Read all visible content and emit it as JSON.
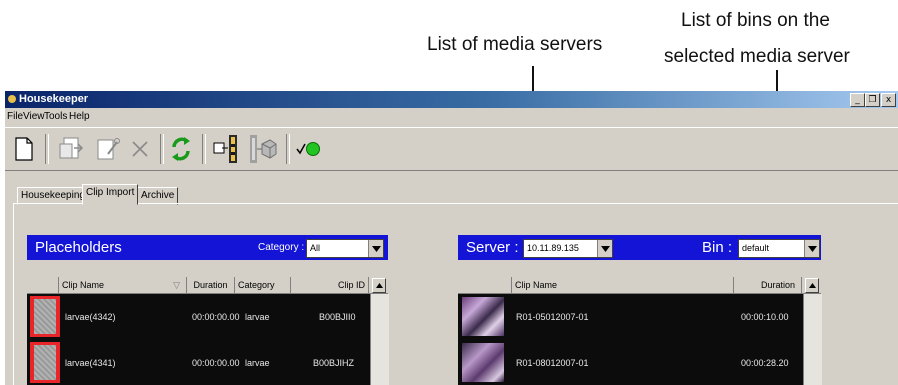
{
  "callouts": {
    "media_servers": "List of media servers",
    "bins_line1": "List of bins on the",
    "bins_line2": "selected media server"
  },
  "window": {
    "title": "Housekeeper",
    "menu": [
      "File",
      "View",
      "Tools",
      "Help"
    ],
    "controls": {
      "minimize": "_",
      "restore": "❐",
      "close": "x"
    }
  },
  "toolbar": {
    "icons": [
      "new-document-icon",
      "move-icon",
      "properties-icon",
      "delete-icon",
      "refresh-icon",
      "import-clip-icon",
      "export-icon",
      "online-status-icon"
    ]
  },
  "tabs": [
    "Housekeeping",
    "Clip Import",
    "Archive"
  ],
  "active_tab": "Clip Import",
  "placeholders": {
    "title": "Placeholders",
    "category_label": "Category :",
    "category_value": "All",
    "columns": [
      "Clip Name",
      "Duration",
      "Category",
      "Clip ID"
    ],
    "rows": [
      {
        "name": "larvae(4342)",
        "duration": "00:00:00.00",
        "category": "larvae",
        "clip_id": "B00BJII0"
      },
      {
        "name": "larvae(4341)",
        "duration": "00:00:00.00",
        "category": "larvae",
        "clip_id": "B00BJIHZ"
      }
    ]
  },
  "server_panel": {
    "server_label": "Server :",
    "server_value": "10.11.89.135",
    "bin_label": "Bin :",
    "bin_value": "default",
    "columns": [
      "Clip Name",
      "Duration"
    ],
    "rows": [
      {
        "name": "R01-05012007-01",
        "duration": "00:00:10.00"
      },
      {
        "name": "R01-08012007-01",
        "duration": "00:00:28.20"
      }
    ]
  },
  "colors": {
    "panel_header": "#1414d6",
    "titlebar": "#0a246a",
    "placeholder_thumb_border": "#e8262a",
    "status_green": "#22c422"
  }
}
